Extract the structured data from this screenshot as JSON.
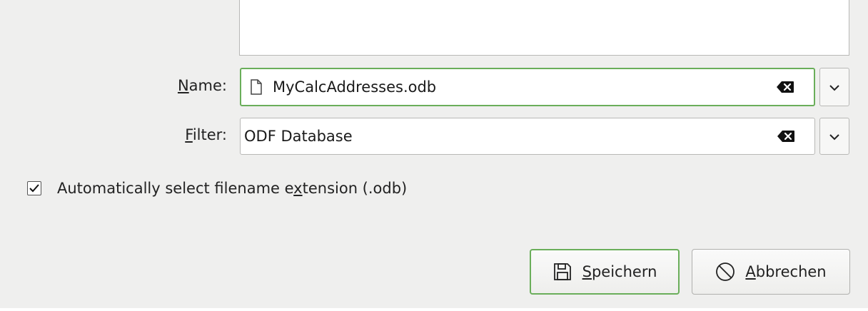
{
  "dialog": {
    "name_label_mnemonic": "N",
    "name_label_rest": "ame:",
    "name_value": "MyCalcAddresses.odb",
    "filter_label_mnemonic": "F",
    "filter_label_rest": "ilter:",
    "filter_value": "ODF Database",
    "auto_ext_checked": true,
    "auto_ext_label_part1": "Automatically select filename e",
    "auto_ext_label_mnemonic": "x",
    "auto_ext_label_part2": "tension (.odb)",
    "save_mnemonic": "S",
    "save_rest": "peichern",
    "cancel_mnemonic": "A",
    "cancel_rest": "bbrechen"
  },
  "icons": {
    "name_field": "document-icon",
    "clear": "clear-text-icon",
    "dropdown": "chevron-down-icon",
    "checkbox": "checkmark-icon",
    "save": "floppy-disk-icon",
    "cancel": "prohibition-icon"
  },
  "colors": {
    "focus_accent": "#6aae5a",
    "background": "#efefee"
  }
}
